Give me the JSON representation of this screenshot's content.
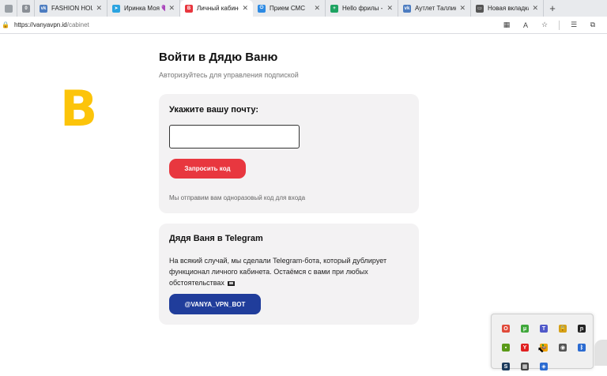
{
  "browser": {
    "tabs": [
      {
        "title": "",
        "favicon": "tab-actions-icon",
        "color": "#9aa0a6",
        "mark": ""
      },
      {
        "title": "",
        "favicon": "pinned-tab-icon",
        "color": "#8a8f96",
        "mark": "0"
      },
      {
        "title": "FASHION HOUSE",
        "favicon": "vk-icon",
        "color": "#4c7cc0",
        "mark": "vk"
      },
      {
        "title": "Иринка Моя 💜",
        "favicon": "telegram-icon",
        "color": "#2aa3e0",
        "mark": "➤"
      },
      {
        "title": "Личный кабинет",
        "favicon": "vanyavpn-icon",
        "color": "#e8373f",
        "mark": "B",
        "active": true
      },
      {
        "title": "Прием СМС",
        "favicon": "power-icon",
        "color": "#2d8ae3",
        "mark": "⏻"
      },
      {
        "title": "Hello фрилы - Go",
        "favicon": "sheets-icon",
        "color": "#1ea362",
        "mark": "+"
      },
      {
        "title": "Аутлет Таллинско",
        "favicon": "vk-icon",
        "color": "#4c7cc0",
        "mark": "vk"
      },
      {
        "title": "Новая вкладка",
        "favicon": "new-tab-page-icon",
        "color": "#555555",
        "mark": "▭"
      }
    ],
    "new_tab_symbol": "+",
    "url_host": "https://vanyavpn.id",
    "url_path": "/cabinet",
    "toolbar_icons": [
      "grid-icon",
      "read-aloud-icon",
      "favorite-star-icon",
      "favorites-list-icon",
      "extensions-icon"
    ]
  },
  "page": {
    "logo_text": "B",
    "title": "Войти в Дядю Ваню",
    "subtitle": "Авторизуйтесь для управления подпиской",
    "login": {
      "heading": "Укажите вашу почту:",
      "email_value": "",
      "button_label": "Запросить код",
      "hint": "Мы отправим вам одноразовый код для входа"
    },
    "telegram": {
      "heading": "Дядя Ваня в Telegram",
      "text": "На всякий случай, мы сделали Telegram-бота, который дублирует функционал личного кабинета. Остаёмся с вами при любых обстоятельствах",
      "button_label": "@VANYA_VPN_BOT"
    }
  },
  "tray": {
    "icons": [
      {
        "name": "opera-gx-icon",
        "color": "#e04a3a",
        "mark": "O"
      },
      {
        "name": "utorrent-icon",
        "color": "#3fa73a",
        "mark": "μ"
      },
      {
        "name": "teams-icon",
        "color": "#5059c9",
        "mark": "T"
      },
      {
        "name": "vpn-lock-icon",
        "color": "#d4a017",
        "mark": "🔒"
      },
      {
        "name": "notion-n-icon",
        "color": "#222222",
        "mark": "ɲ"
      },
      {
        "name": "nvidia-icon",
        "color": "#5a9a18",
        "mark": "▪"
      },
      {
        "name": "yandex-icon",
        "color": "#e02020",
        "mark": "Y"
      },
      {
        "name": "vanyavpn-tray-icon",
        "color": "#f0a500",
        "mark": "🦆"
      },
      {
        "name": "eye-off-icon",
        "color": "#555555",
        "mark": "◉"
      },
      {
        "name": "bluetooth-icon",
        "color": "#2b6bd1",
        "mark": "ᛒ"
      },
      {
        "name": "steam-icon",
        "color": "#1b3a5c",
        "mark": "S"
      },
      {
        "name": "app-tray-icon",
        "color": "#444444",
        "mark": "▦"
      },
      {
        "name": "shield-tray-icon",
        "color": "#2b6bd1",
        "mark": "◈"
      }
    ]
  }
}
